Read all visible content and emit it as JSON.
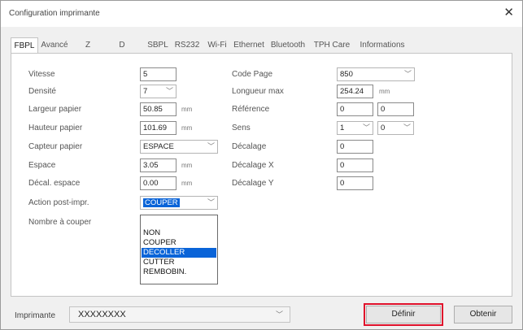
{
  "window": {
    "title": "Configuration imprimante",
    "close_glyph": "✕",
    "close_icon": "close-icon"
  },
  "tabs": [
    {
      "label": "FBPL",
      "active": true
    },
    {
      "label": "Avancé"
    },
    {
      "label": "Z"
    },
    {
      "label": "D"
    },
    {
      "label": "SBPL"
    },
    {
      "label": "RS232"
    },
    {
      "label": "Wi-Fi"
    },
    {
      "label": "Ethernet"
    },
    {
      "label": "Bluetooth"
    },
    {
      "label": "TPH Care"
    },
    {
      "label": "Informations"
    }
  ],
  "left": {
    "vitesse": {
      "label": "Vitesse",
      "value": "5"
    },
    "densite": {
      "label": "Densité",
      "value": "7"
    },
    "largeur": {
      "label": "Largeur papier",
      "value": "50.85",
      "unit": "mm"
    },
    "hauteur": {
      "label": "Hauteur papier",
      "value": "101.69",
      "unit": "mm"
    },
    "capteur": {
      "label": "Capteur papier",
      "value": "ESPACE"
    },
    "espace": {
      "label": "Espace",
      "value": "3.05",
      "unit": "mm"
    },
    "decal_espace": {
      "label": "Décal. espace",
      "value": "0.00",
      "unit": "mm"
    },
    "action": {
      "label": "Action post-impr.",
      "value": "COUPER"
    },
    "nombre": {
      "label": "Nombre à couper"
    }
  },
  "right": {
    "code_page": {
      "label": "Code Page",
      "value": "850"
    },
    "longueur": {
      "label": "Longueur max",
      "value": "254.24",
      "unit": "mm"
    },
    "reference": {
      "label": "Référence",
      "value1": "0",
      "value2": "0"
    },
    "sens": {
      "label": "Sens",
      "value1": "1",
      "value2": "0"
    },
    "decalage": {
      "label": "Décalage",
      "value": "0"
    },
    "decalage_x": {
      "label": "Décalage X",
      "value": "0"
    },
    "decalage_y": {
      "label": "Décalage Y",
      "value": "0"
    }
  },
  "dropdown_options": [
    "NON",
    "COUPER",
    "DECOLLER",
    "CUTTER",
    "REMBOBIN."
  ],
  "dropdown_highlighted": "DECOLLER",
  "bottom": {
    "printer_label": "Imprimante",
    "printer_value": "XXXXXXXX",
    "define_button": "Définir",
    "get_button": "Obtenir"
  },
  "colors": {
    "selection": "#0a64d8",
    "highlight_box": "#e0112b"
  }
}
